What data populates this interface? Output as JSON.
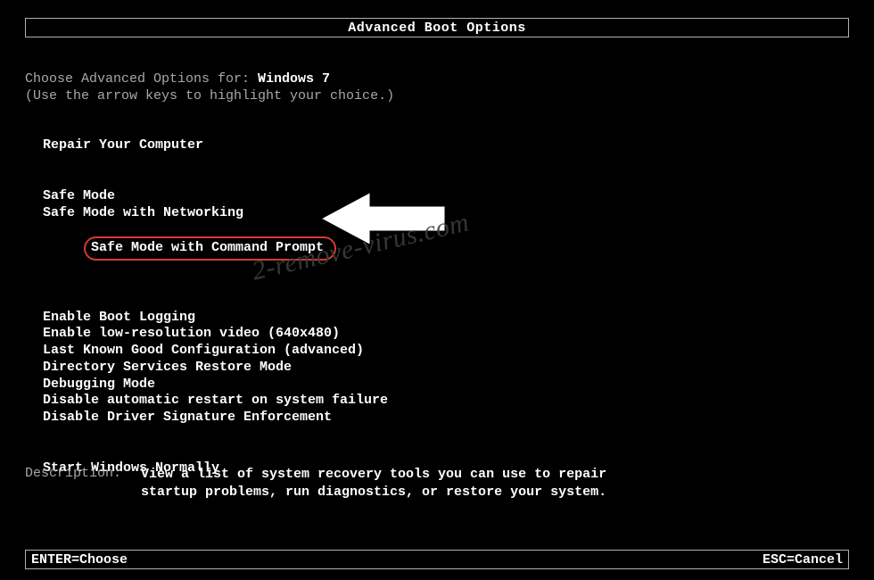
{
  "title": "Advanced Boot Options",
  "prompt": {
    "prefix": "Choose Advanced Options for: ",
    "os": "Windows 7",
    "hint": "(Use the arrow keys to highlight your choice.)"
  },
  "menu": {
    "group1": [
      "Repair Your Computer"
    ],
    "group2": [
      "Safe Mode",
      "Safe Mode with Networking",
      "Safe Mode with Command Prompt"
    ],
    "group3": [
      "Enable Boot Logging",
      "Enable low-resolution video (640x480)",
      "Last Known Good Configuration (advanced)",
      "Directory Services Restore Mode",
      "Debugging Mode",
      "Disable automatic restart on system failure",
      "Disable Driver Signature Enforcement"
    ],
    "group4": [
      "Start Windows Normally"
    ],
    "highlighted_index": {
      "group": "group2",
      "idx": 2
    }
  },
  "description": {
    "label": "Description:",
    "text": "View a list of system recovery tools you can use to repair startup problems, run diagnostics, or restore your system."
  },
  "footer": {
    "left": "ENTER=Choose",
    "right": "ESC=Cancel"
  },
  "annotation": {
    "watermark": "2-remove-virus.com",
    "highlight_color": "#d43c2f"
  }
}
